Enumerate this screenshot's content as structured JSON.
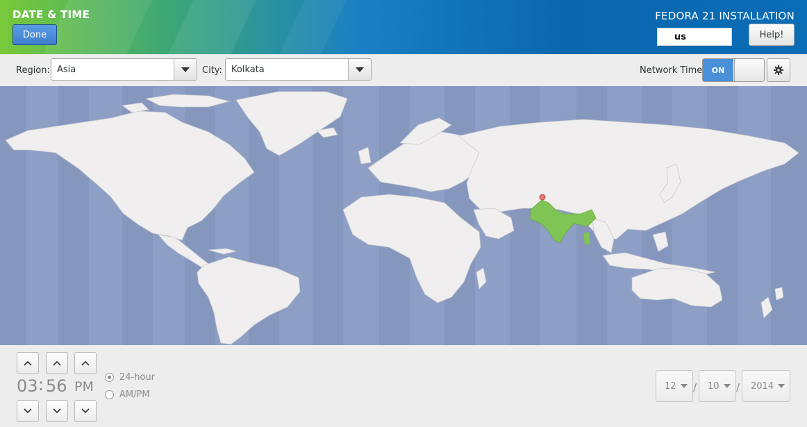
{
  "header": {
    "title": "DATE & TIME",
    "done_label": "Done",
    "product": "FEDORA 21 INSTALLATION",
    "keyboard_layout": "us",
    "help_label": "Help!"
  },
  "toolbar": {
    "region_label": "Region:",
    "region_value": "Asia",
    "city_label": "City:",
    "city_value": "Kolkata",
    "network_time_label": "Network Time",
    "network_time_state": "ON",
    "settings_icon": "gear-icon"
  },
  "map": {
    "selected_country": "India",
    "ocean_color": "#8d9fc4",
    "land_color": "#f0eeee",
    "highlight_color": "#80c456",
    "pin_color": "#e8786c"
  },
  "time": {
    "hours": "03",
    "separator": ":",
    "minutes": "56",
    "period": "PM",
    "format_24": "24-hour",
    "format_ampm": "AM/PM",
    "selected_format": "24-hour"
  },
  "date": {
    "month": "12",
    "day": "10",
    "year": "2014",
    "separator": "/"
  },
  "colors": {
    "accent": "#4a90d9"
  }
}
